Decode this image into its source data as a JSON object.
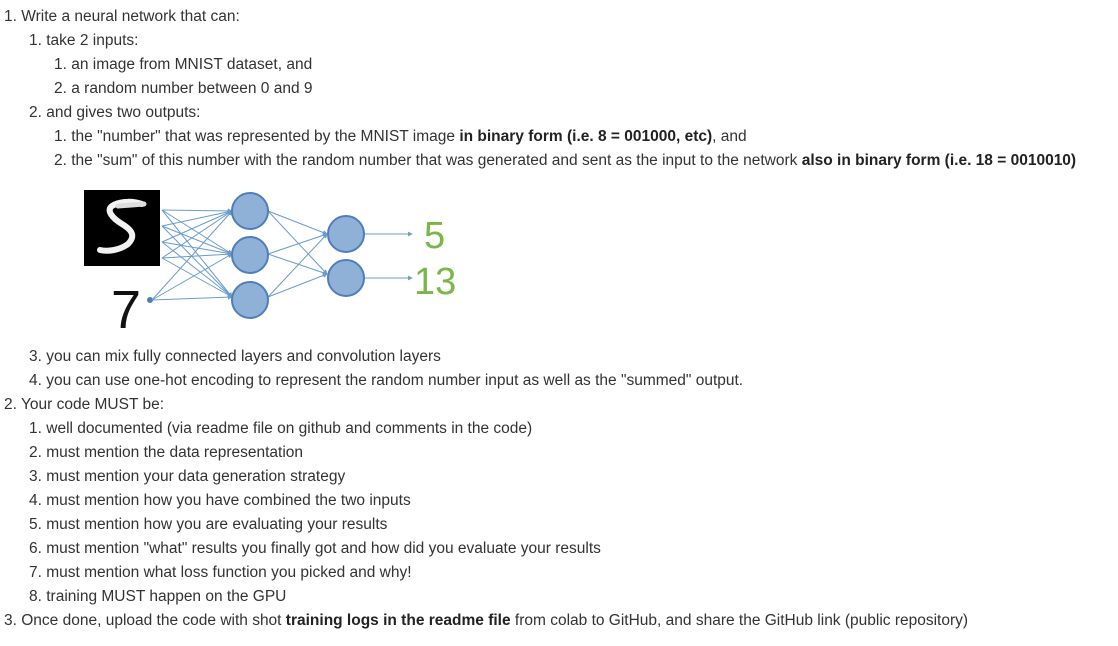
{
  "items": {
    "i1": {
      "num": "1.",
      "text": "Write a neural network that can:"
    },
    "i1_1": {
      "num": "1.",
      "text": "take 2 inputs:"
    },
    "i1_1_1": {
      "num": "1.",
      "text": "an image from MNIST dataset, and"
    },
    "i1_1_2": {
      "num": "2.",
      "text": "a random number between 0 and 9"
    },
    "i1_2": {
      "num": "2.",
      "text": "and gives two outputs:"
    },
    "i1_2_1": {
      "num": "1.",
      "text_a": "the \"number\" that was represented by the MNIST image ",
      "bold": "in binary form (i.e. 8 = 001000, etc)",
      "text_b": ", and"
    },
    "i1_2_2": {
      "num": "2.",
      "text_a": "the \"sum\" of this number with the random number that was generated and sent as the input to the network ",
      "bold": "also in binary form (i.e. 18 = 0010010)"
    },
    "i1_3": {
      "num": "3.",
      "text": "you can mix fully connected layers and convolution layers"
    },
    "i1_4": {
      "num": "4.",
      "text": "you can use one-hot encoding to represent the random number input as well as the \"summed\" output."
    },
    "i2": {
      "num": "2.",
      "text": "Your code MUST be:"
    },
    "i2_1": {
      "num": "1.",
      "text": "well documented (via readme file on github and comments in the code)"
    },
    "i2_2": {
      "num": "2.",
      "text": "must mention the data representation"
    },
    "i2_3": {
      "num": "3.",
      "text": "must mention your data generation strategy"
    },
    "i2_4": {
      "num": "4.",
      "text": "must mention how you have combined the two inputs"
    },
    "i2_5": {
      "num": "5.",
      "text": "must mention how you are evaluating your results"
    },
    "i2_6": {
      "num": "6.",
      "text": "must mention \"what\" results you finally got and how did you evaluate your results"
    },
    "i2_7": {
      "num": "7.",
      "text": "must mention what loss function you picked and why!"
    },
    "i2_8": {
      "num": "8.",
      "text": "training MUST happen on the GPU"
    },
    "i3": {
      "num": "3.",
      "text_a": "Once done, upload the code with shot ",
      "bold": "training logs in the readme file",
      "text_b": " from colab to GitHub, and share the GitHub link (public repository)"
    }
  },
  "diagram": {
    "input_number": "7",
    "outputs": [
      "5",
      "13"
    ],
    "colors": {
      "node_fill": "#8fb1d8",
      "node_stroke": "#4f7fb8",
      "edge": "#6a9bd0",
      "output_text": "#7ab648",
      "image_bg": "#000000"
    }
  }
}
